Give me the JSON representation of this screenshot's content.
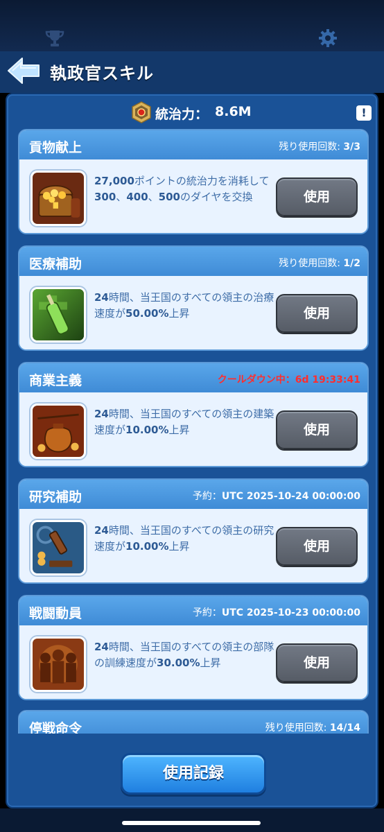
{
  "header": {
    "title": "執政官スキル"
  },
  "governance": {
    "label": "統治力：",
    "value": "8.6M"
  },
  "info_label": "!",
  "skills": [
    {
      "name": "貢物献上",
      "status_label": "残り使用回数: ",
      "status_value": "3/3",
      "desc_html_parts": [
        "27,000",
        "ポイントの統治力を消耗して",
        "300",
        "、",
        "400",
        "、",
        "500",
        "のダイヤを交換"
      ],
      "button": "使用"
    },
    {
      "name": "医療補助",
      "status_label": "残り使用回数: ",
      "status_value": "1/2",
      "desc_html_parts": [
        "24",
        "時間、当王国のすべての領主の治療速度が",
        "50.00%",
        "上昇"
      ],
      "button": "使用"
    },
    {
      "name": "商業主義",
      "status_label": "クールダウン中：",
      "status_value": "6d 19:33:41",
      "desc_html_parts": [
        "24",
        "時間、当王国のすべての領主の建築速度が",
        "10.00%",
        "上昇"
      ],
      "button": "使用"
    },
    {
      "name": "研究補助",
      "status_label": "予約：",
      "status_value": "UTC 2025-10-24 00:00:00",
      "desc_html_parts": [
        "24",
        "時間、当王国のすべての領主の研究速度が",
        "10.00%",
        "上昇"
      ],
      "button": "使用"
    },
    {
      "name": "戦闘動員",
      "status_label": "予約：",
      "status_value": "UTC 2025-10-23 00:00:00",
      "desc_html_parts": [
        "24",
        "時間、当王国のすべての領主の部隊の訓練速度が",
        "30.00%",
        "上昇"
      ],
      "button": "使用"
    },
    {
      "name": "停戦命令",
      "status_label": "残り使用回数: ",
      "status_value": "14/14"
    }
  ],
  "record_button": "使用記録",
  "colors": {
    "panel": "#1a5297",
    "card_head": "#4b98df",
    "cooldown": "#ff2d2d",
    "use_button": "#636a75",
    "record_button": "#2f93ef"
  },
  "icons": {
    "top_left": "trophy-icon",
    "top_right": "gear-icon",
    "back": "back-arrow-icon",
    "governance": "governance-gem-icon"
  }
}
